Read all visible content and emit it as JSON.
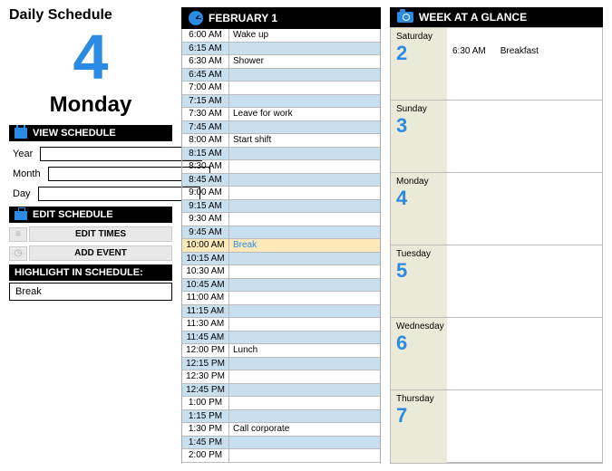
{
  "title": "Daily Schedule",
  "bigDate": "4",
  "dayName": "Monday",
  "viewSchedule": {
    "header": "VIEW SCHEDULE",
    "yearLabel": "Year",
    "monthLabel": "Month",
    "dayLabel": "Day"
  },
  "editSchedule": {
    "header": "EDIT SCHEDULE",
    "editTimes": "EDIT TIMES",
    "addEvent": "ADD EVENT"
  },
  "highlight": {
    "header": "HIGHLIGHT IN SCHEDULE:",
    "value": "Break"
  },
  "scheduleHeader": "FEBRUARY 1",
  "schedule": [
    {
      "time": "6:00 AM",
      "event": "Wake up",
      "alt": false
    },
    {
      "time": "6:15 AM",
      "event": "",
      "alt": true
    },
    {
      "time": "6:30 AM",
      "event": "Shower",
      "alt": false
    },
    {
      "time": "6:45 AM",
      "event": "",
      "alt": true
    },
    {
      "time": "7:00 AM",
      "event": "",
      "alt": false
    },
    {
      "time": "7:15 AM",
      "event": "",
      "alt": true
    },
    {
      "time": "7:30 AM",
      "event": "Leave for work",
      "alt": false
    },
    {
      "time": "7:45 AM",
      "event": "",
      "alt": true
    },
    {
      "time": "8:00 AM",
      "event": "Start shift",
      "alt": false
    },
    {
      "time": "8:15 AM",
      "event": "",
      "alt": true
    },
    {
      "time": "8:30 AM",
      "event": "",
      "alt": false
    },
    {
      "time": "8:45 AM",
      "event": "",
      "alt": true
    },
    {
      "time": "9:00 AM",
      "event": "",
      "alt": false
    },
    {
      "time": "9:15 AM",
      "event": "",
      "alt": true
    },
    {
      "time": "9:30 AM",
      "event": "",
      "alt": false
    },
    {
      "time": "9:45 AM",
      "event": "",
      "alt": true
    },
    {
      "time": "10:00 AM",
      "event": "Break",
      "alt": false,
      "highlight": true
    },
    {
      "time": "10:15 AM",
      "event": "",
      "alt": true
    },
    {
      "time": "10:30 AM",
      "event": "",
      "alt": false
    },
    {
      "time": "10:45 AM",
      "event": "",
      "alt": true
    },
    {
      "time": "11:00 AM",
      "event": "",
      "alt": false
    },
    {
      "time": "11:15 AM",
      "event": "",
      "alt": true
    },
    {
      "time": "11:30 AM",
      "event": "",
      "alt": false
    },
    {
      "time": "11:45 AM",
      "event": "",
      "alt": true
    },
    {
      "time": "12:00 PM",
      "event": "Lunch",
      "alt": false
    },
    {
      "time": "12:15 PM",
      "event": "",
      "alt": true
    },
    {
      "time": "12:30 PM",
      "event": "",
      "alt": false
    },
    {
      "time": "12:45 PM",
      "event": "",
      "alt": true
    },
    {
      "time": "1:00 PM",
      "event": "",
      "alt": false
    },
    {
      "time": "1:15 PM",
      "event": "",
      "alt": true
    },
    {
      "time": "1:30 PM",
      "event": "Call corporate",
      "alt": false
    },
    {
      "time": "1:45 PM",
      "event": "",
      "alt": true
    },
    {
      "time": "2:00 PM",
      "event": "",
      "alt": false
    }
  ],
  "weekHeader": "WEEK AT A GLANCE",
  "weekDays": [
    {
      "name": "Saturday",
      "num": "2",
      "evTime": "6:30 AM",
      "evText": "Breakfast"
    },
    {
      "name": "Sunday",
      "num": "3"
    },
    {
      "name": "Monday",
      "num": "4"
    },
    {
      "name": "Tuesday",
      "num": "5"
    },
    {
      "name": "Wednesday",
      "num": "6"
    },
    {
      "name": "Thursday",
      "num": "7"
    }
  ]
}
